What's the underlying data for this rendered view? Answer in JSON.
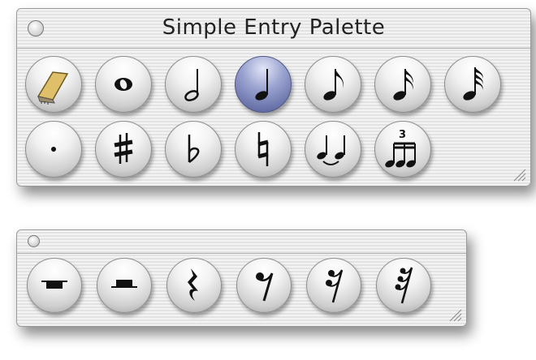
{
  "main_palette": {
    "title": "Simple Entry Palette",
    "row1": [
      "eraser-icon",
      "whole-note-icon",
      "half-note-icon",
      "quarter-note-icon",
      "eighth-note-icon",
      "sixteenth-note-icon",
      "thirty-second-note-icon"
    ],
    "row2": [
      "dot-icon",
      "sharp-icon",
      "flat-icon",
      "natural-icon",
      "tie-icon",
      "tuplet-icon"
    ],
    "selected": "quarter-note-icon",
    "tuplet_number": "3"
  },
  "rest_palette": {
    "items": [
      "whole-rest-icon",
      "half-rest-icon",
      "quarter-rest-icon",
      "eighth-rest-icon",
      "sixteenth-rest-icon",
      "thirty-second-rest-icon"
    ]
  }
}
